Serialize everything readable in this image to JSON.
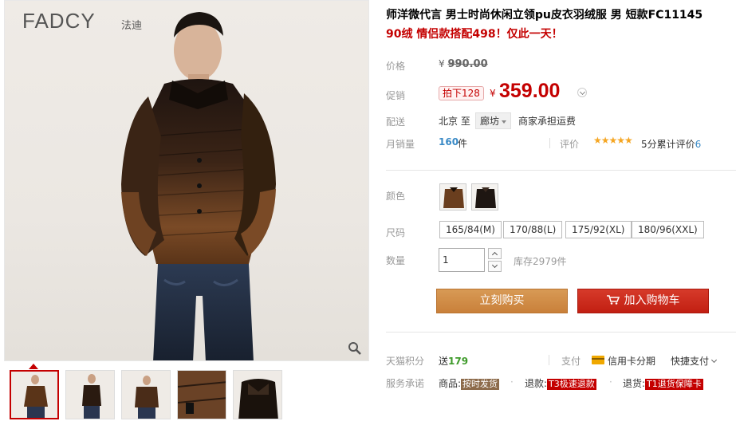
{
  "gallery": {
    "brand_logo": "FADCY",
    "brand_logo_cn": "法迪"
  },
  "product": {
    "title": "师洋微代言 男士时尚休闲立领pu皮衣羽绒服 男 短款FC11145",
    "subtitle": "90绒 情侣款搭配498！仅此一天！"
  },
  "price": {
    "label": "价格",
    "currency": "¥",
    "original": "990.00",
    "promo_label": "促销",
    "promo_badge": "拍下128",
    "promo_currency": "¥",
    "promo_value": "359.00"
  },
  "shipping": {
    "label": "配送",
    "from": "北京  至",
    "to": "廊坊",
    "fee": "商家承担运费"
  },
  "sales": {
    "label": "月销量",
    "count": "160",
    "unit": "件",
    "review_label": "评价",
    "stars": "★★★★★",
    "rating_text": "5分累计评价",
    "review_count": "6"
  },
  "options": {
    "color_label": "颜色",
    "size_label": "尺码",
    "sizes": [
      "165/84(M)",
      "170/88(L)",
      "175/92(XL)",
      "180/96(XXL)"
    ],
    "qty_label": "数量",
    "qty_value": "1",
    "stock": "库存2979件"
  },
  "actions": {
    "buy_now": "立刻购买",
    "add_to_cart": "加入购物车"
  },
  "points": {
    "label": "天猫积分",
    "prefix": "送",
    "value": "179"
  },
  "payment": {
    "label": "支付",
    "card": "信用卡分期",
    "quickpay": "快捷支付"
  },
  "service": {
    "label": "服务承诺",
    "item1_prefix": "商品:",
    "item1_tag": "按时发货",
    "item2_prefix": "退款:",
    "item2_tag": "T3极速退款",
    "item3_prefix": "退货:",
    "item3_tag": "T1退货保障卡"
  },
  "colors": {
    "price_red": "#c40000",
    "buy_orange": "#c9803a",
    "cart_red": "#c21f12",
    "link_blue": "#3a8ac6",
    "points_green": "#3e9a2a"
  }
}
